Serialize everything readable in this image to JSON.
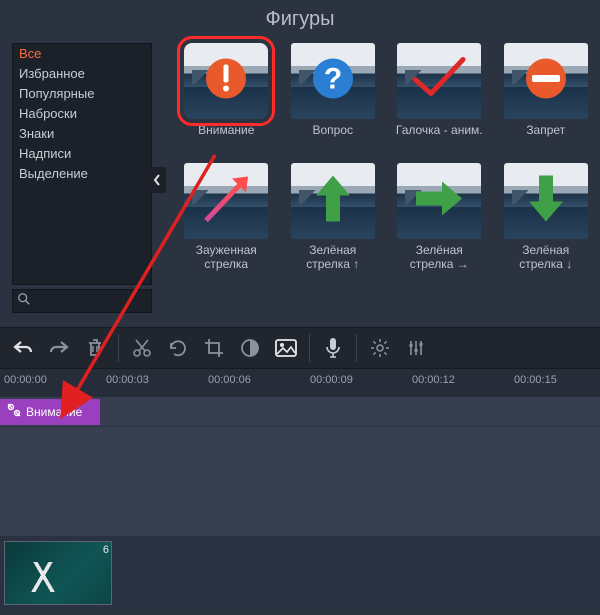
{
  "panel_title": "Фигуры",
  "sidebar": {
    "categories": [
      {
        "label": "Все",
        "selected": true
      },
      {
        "label": "Избранное",
        "selected": false
      },
      {
        "label": "Популярные",
        "selected": false
      },
      {
        "label": "Наброски",
        "selected": false
      },
      {
        "label": "Знаки",
        "selected": false
      },
      {
        "label": "Надписи",
        "selected": false
      },
      {
        "label": "Выделение",
        "selected": false
      }
    ],
    "search_placeholder": ""
  },
  "shapes": [
    {
      "id": "attention",
      "caption": "Внимание",
      "highlight": true
    },
    {
      "id": "question",
      "caption": "Вопрос"
    },
    {
      "id": "checkmark",
      "caption": "Галочка - аним."
    },
    {
      "id": "prohibit",
      "caption": "Запрет"
    },
    {
      "id": "narrow",
      "caption": "Зауженная стрелка"
    },
    {
      "id": "arrow-up",
      "caption": "Зелёная стрелка ↑"
    },
    {
      "id": "arrow-rt",
      "caption": "Зелёная стрелка →"
    },
    {
      "id": "arrow-dn",
      "caption": "Зелёная стрелка ↓"
    }
  ],
  "toolbar": {
    "undo": "undo",
    "redo": "redo",
    "delete": "delete",
    "cut": "cut",
    "rotate": "rotate",
    "crop": "crop",
    "color": "color",
    "image": "image",
    "mic": "mic",
    "gear": "gear",
    "sliders": "sliders"
  },
  "ruler": [
    "00:00:00",
    "00:00:03",
    "00:00:06",
    "00:00:09",
    "00:00:12",
    "00:00:15"
  ],
  "title_clip": {
    "label": "Внимание"
  },
  "video_clip": {
    "duration_digit": "6"
  }
}
